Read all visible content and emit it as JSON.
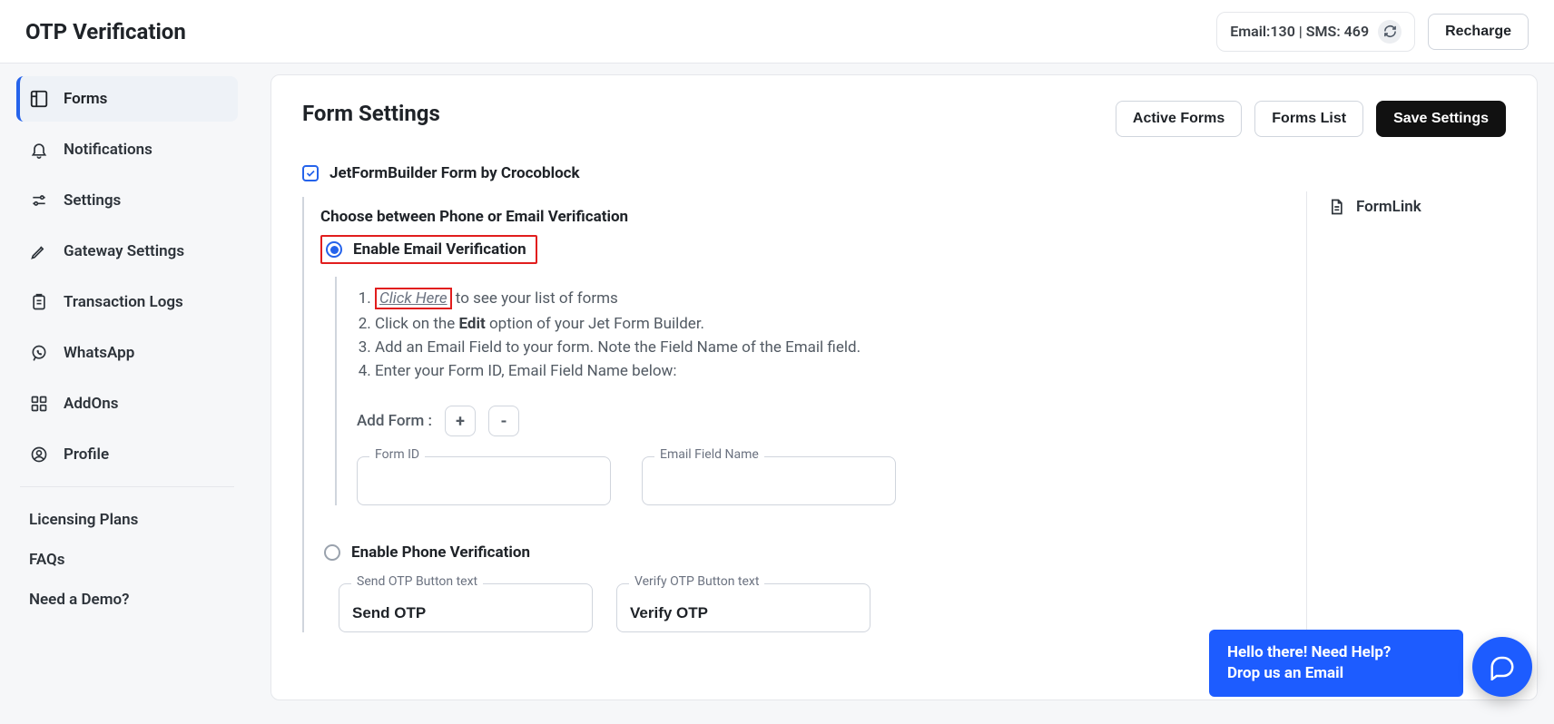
{
  "page_title": "OTP Verification",
  "balance": {
    "text": "Email:130 | SMS: 469"
  },
  "recharge_label": "Recharge",
  "sidebar": {
    "items": [
      {
        "label": "Forms",
        "icon": "layout-icon",
        "active": true
      },
      {
        "label": "Notifications",
        "icon": "bell-icon"
      },
      {
        "label": "Settings",
        "icon": "sliders-icon"
      },
      {
        "label": "Gateway Settings",
        "icon": "edit-icon"
      },
      {
        "label": "Transaction Logs",
        "icon": "clipboard-icon"
      },
      {
        "label": "WhatsApp",
        "icon": "whatsapp-icon"
      },
      {
        "label": "AddOns",
        "icon": "grid-icon"
      },
      {
        "label": "Profile",
        "icon": "user-icon"
      }
    ],
    "links": [
      {
        "label": "Licensing Plans"
      },
      {
        "label": "FAQs"
      },
      {
        "label": "Need a Demo?"
      }
    ]
  },
  "main": {
    "title": "Form Settings",
    "actions": {
      "active_forms": "Active Forms",
      "forms_list": "Forms List",
      "save": "Save Settings"
    },
    "plugin_checkbox_label": "JetFormBuilder Form by Crocoblock",
    "choose_head": "Choose between Phone or Email Verification",
    "radio_email_label": "Enable Email Verification",
    "radio_phone_label": "Enable Phone Verification",
    "instructions": {
      "click_here": "Click Here",
      "step1_rest": " to see your list of forms",
      "step2_a": "Click on the ",
      "step2_bold": "Edit",
      "step2_b": " option of your Jet Form Builder.",
      "step3": "Add an Email Field to your form. Note the Field Name of the Email field.",
      "step4": "Enter your Form ID, Email Field Name below:"
    },
    "add_form_label": "Add Form :",
    "plus": "+",
    "minus": "-",
    "form_id_label": "Form ID",
    "form_id_value": "",
    "email_field_label": "Email Field Name",
    "email_field_value": "",
    "send_otp_label": "Send OTP Button text",
    "send_otp_value": "Send OTP",
    "verify_otp_label": "Verify OTP Button text",
    "verify_otp_value": "Verify OTP",
    "aside_formlink": "FormLink"
  },
  "help": {
    "line1": "Hello there! Need Help?",
    "line2": "Drop us an Email"
  }
}
